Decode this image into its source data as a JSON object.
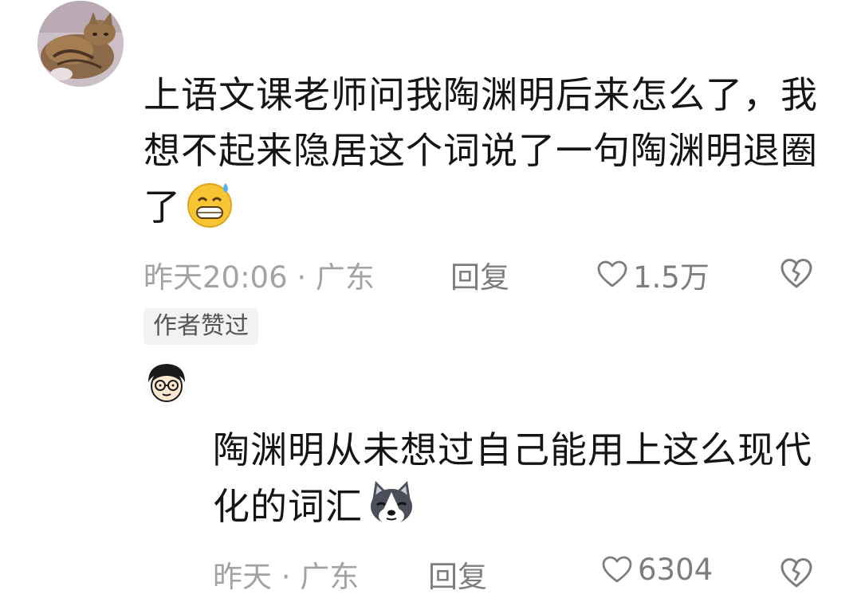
{
  "comment": {
    "text": "上语文课老师问我陶渊明后来怎么了，我想不起来隐居这个词说了一句陶渊明退圈了",
    "emoji": "grinning-sweat-emoji",
    "time": "昨天20:06 · 广东",
    "reply_label": "回复",
    "likes": "1.5万",
    "author_badge": "作者赞过"
  },
  "reply": {
    "text": "陶渊明从未想过自己能用上这么现代化的词汇",
    "emoji": "husky-dog-emoji",
    "time": "昨天 · 广东",
    "reply_label": "回复",
    "likes": "6304"
  },
  "colors": {
    "text": "#151515",
    "meta": "#a3a3a3",
    "action": "#7d7d7d",
    "badge_bg": "#f2f2f2"
  }
}
